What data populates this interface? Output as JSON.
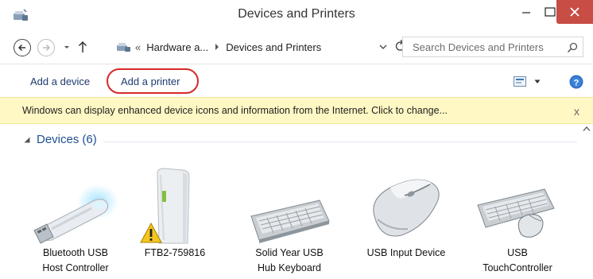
{
  "window": {
    "title": "Devices and Printers"
  },
  "addressbar": {
    "overflow": "«",
    "crumbs": [
      "Hardware a...",
      "Devices and Printers"
    ],
    "search_placeholder": "Search Devices and Printers"
  },
  "commandbar": {
    "add_device": "Add a device",
    "add_printer": "Add a printer"
  },
  "infobar": {
    "message": "Windows can display enhanced device icons and information from the Internet. Click to change...",
    "close": "x"
  },
  "group": {
    "title": "Devices",
    "count": "(6)"
  },
  "devices": [
    {
      "line1": "Bluetooth USB",
      "line2": "Host Controller",
      "icon": "usb-dongle-icon"
    },
    {
      "line1": "FTB2-759816",
      "line2": "",
      "icon": "computer-tower-icon"
    },
    {
      "line1": "Solid Year USB",
      "line2": "Hub Keyboard",
      "icon": "keyboard-icon"
    },
    {
      "line1": "USB Input Device",
      "line2": "",
      "icon": "mouse-icon"
    },
    {
      "line1": "USB",
      "line2": "TouchController",
      "icon": "keyboard-mouse-icon"
    }
  ],
  "colors": {
    "close_button": "#c74d45",
    "highlight": "#d62828",
    "infobar_bg": "#fff8c4",
    "link": "#1e3b6e",
    "group_title": "#1e4f91"
  }
}
